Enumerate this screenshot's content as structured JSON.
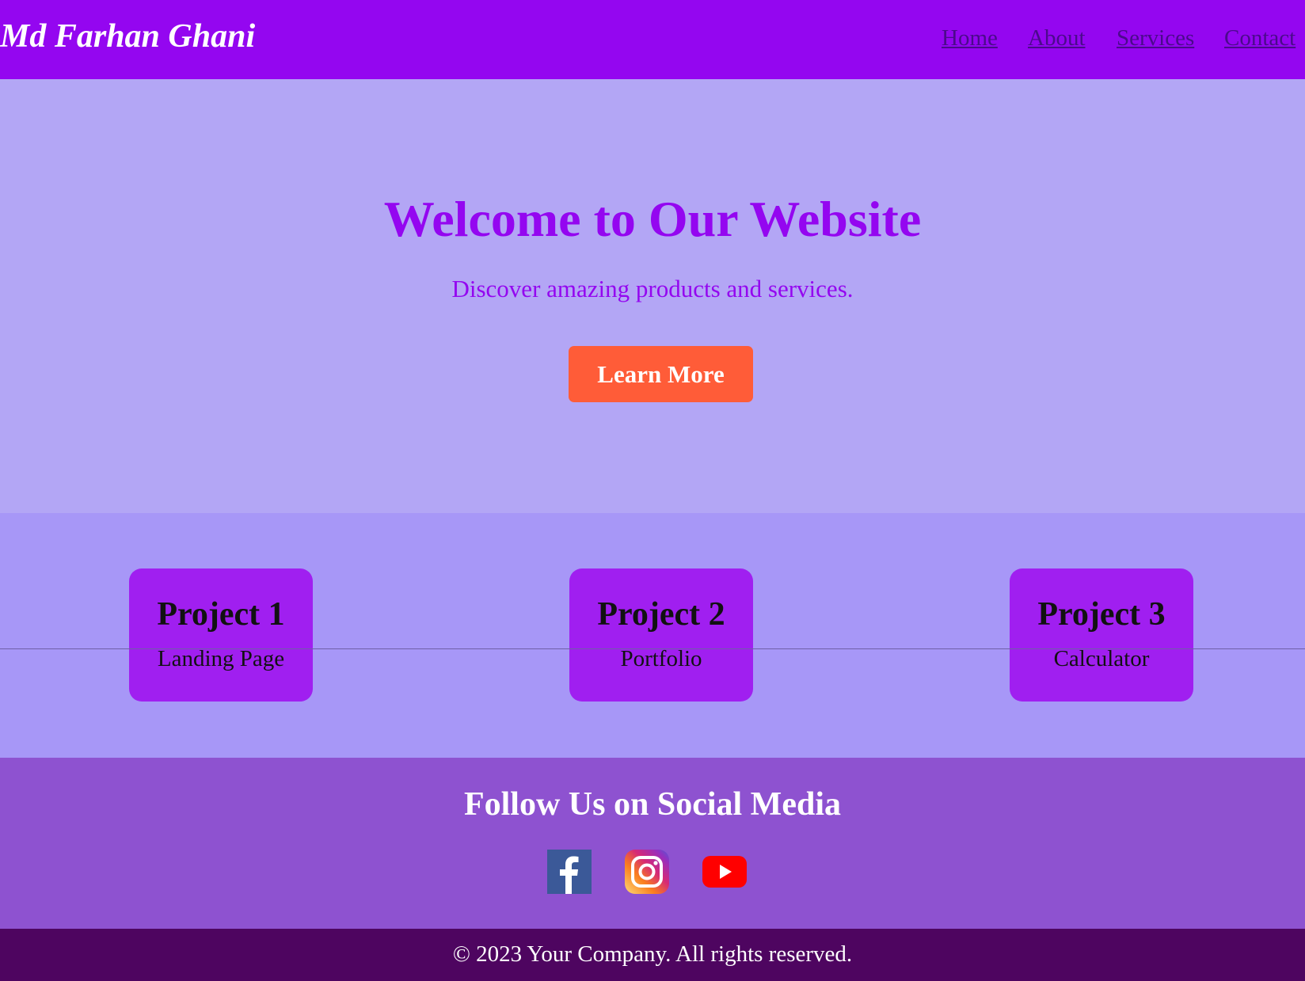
{
  "header": {
    "brand": "Md Farhan Ghani",
    "nav": [
      "Home",
      "About",
      "Services",
      "Contact"
    ]
  },
  "hero": {
    "title": "Welcome to Our Website",
    "subtitle": "Discover amazing products and services.",
    "button": "Learn More"
  },
  "projects": [
    {
      "title": "Project 1",
      "subtitle": "Landing Page"
    },
    {
      "title": "Project 2",
      "subtitle": "Portfolio"
    },
    {
      "title": "Project 3",
      "subtitle": "Calculator"
    }
  ],
  "social": {
    "title": "Follow Us on Social Media",
    "icons": [
      "facebook-icon",
      "instagram-icon",
      "youtube-icon"
    ]
  },
  "footer": {
    "text": "© 2023 Your Company. All rights reserved."
  },
  "colors": {
    "header_bg": "#9406f0",
    "hero_bg": "#b3a6f5",
    "projects_bg": "#a797f7",
    "card_bg": "#a01ff0",
    "accent_button": "#ff5c38",
    "social_bg": "#8e52d0",
    "footer_bg": "#4e0560"
  }
}
